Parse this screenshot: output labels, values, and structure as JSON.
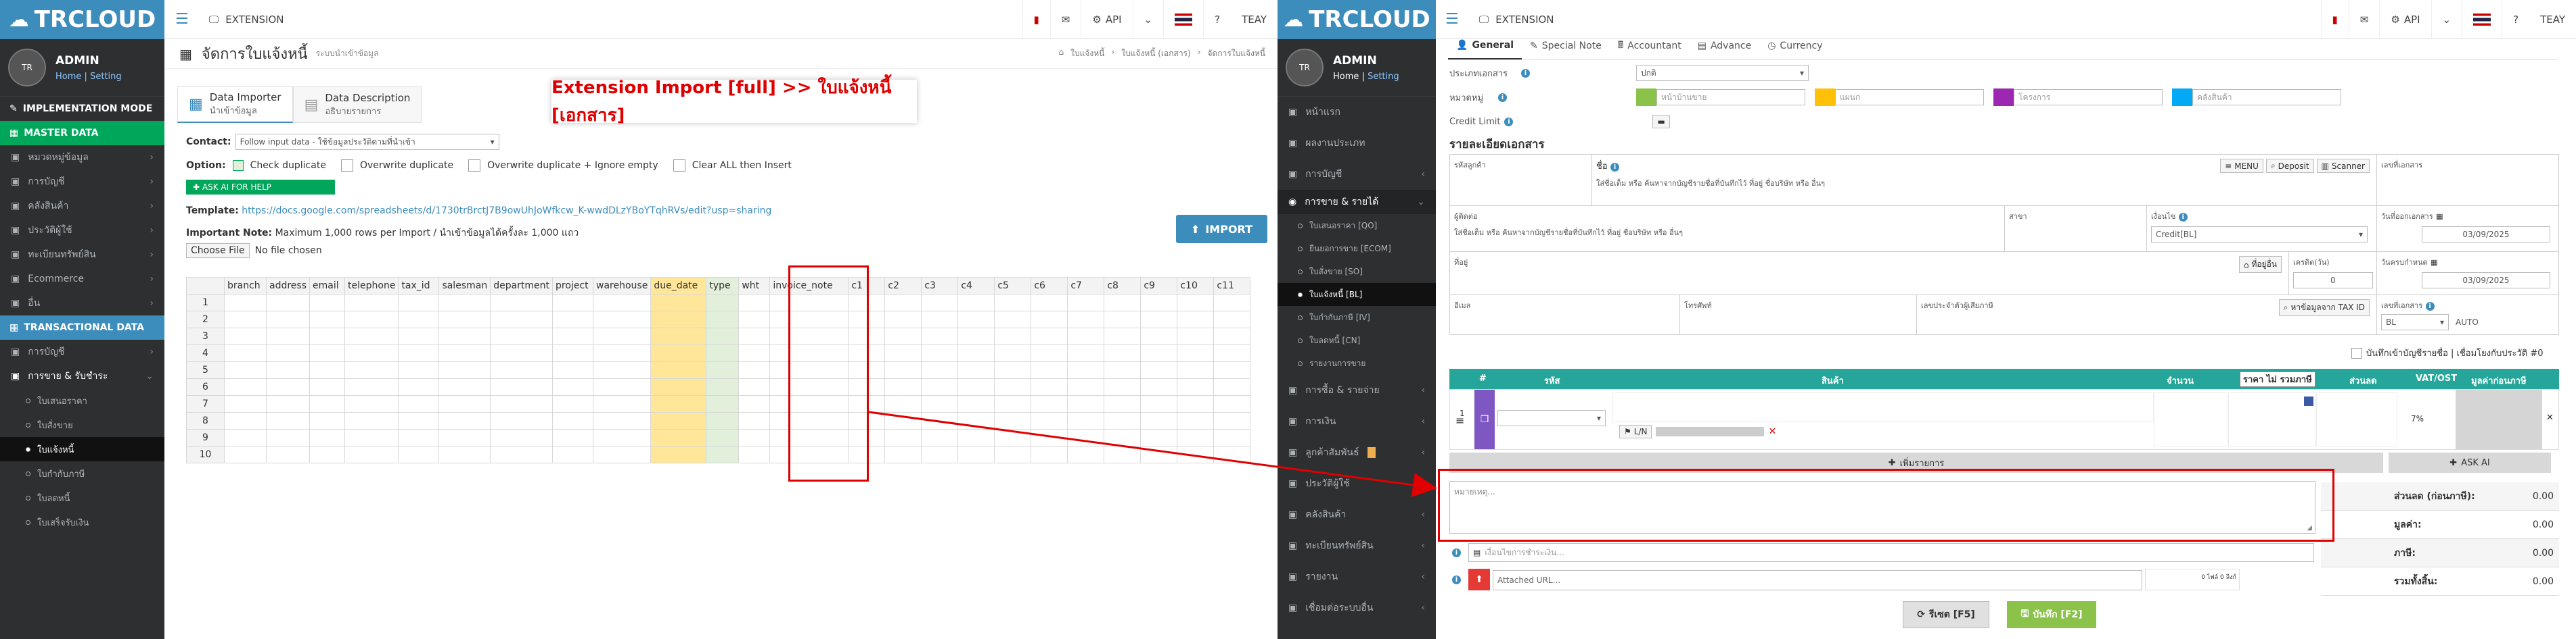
{
  "left_app": {
    "brand": "TRCLOUD",
    "user": {
      "name": "ADMIN",
      "home": "Home",
      "setting": "Setting",
      "sep": "|"
    },
    "topbar": {
      "extension": "EXTENSION",
      "api": "API",
      "user_short": "TEAY"
    },
    "sidebar": {
      "impl_mode": "IMPLEMENTATION MODE",
      "master_data": "MASTER DATA",
      "master_items": [
        "หมวดหมู่ข้อมูล",
        "การบัญชี",
        "คลังสินค้า",
        "ประวัติผู้ใช้",
        "ทะเบียนทรัพย์สิน",
        "Ecommerce",
        "อื่น"
      ],
      "transactional": "TRANSACTIONAL DATA",
      "trans_items": [
        "การบัญชี",
        "การขาย & รับชำระ"
      ],
      "sub_items": [
        "ใบเสนอราคา",
        "ใบสั่งขาย",
        "ใบแจ้งหนี้",
        "ใบกำกับภาษี",
        "ใบลดหนี้",
        "ใบเสร็จรับเงิน"
      ],
      "active_sub": 2
    },
    "page": {
      "title": "จัดการใบแจ้งหนี้",
      "subtitle": "ระบบนำเข้าข้อมูล",
      "breadcrumb": [
        "ใบแจ้งหนี้",
        "ใบแจ้งหนี้ (เอกสาร)",
        "จัดการใบแจ้งหนี้"
      ],
      "tabs": [
        {
          "title": "Data Importer",
          "sub": "นำเข้าข้อมูล"
        },
        {
          "title": "Data Description",
          "sub": "อธิบายรายการ"
        }
      ],
      "contact_label": "Contact:",
      "contact_value": "Follow input data - ใช้ข้อมูลประวัติตามที่นำเข้า",
      "option_label": "Option:",
      "options": [
        "Check duplicate",
        "Overwrite duplicate",
        "Overwrite duplicate + Ignore empty",
        "Clear ALL then Insert"
      ],
      "ask_ai": "ASK AI FOR HELP",
      "template_label": "Template:",
      "template_url": "https://docs.google.com/spreadsheets/d/1730trBrctJ7B9owUhJoWfkcw_K-wwdDLzYBoYTqhRVs/edit?usp=sharing",
      "important_label": "Important Note:",
      "important_text": "Maximum 1,000 rows per Import / นำเข้าข้อมูลได้ครั้งละ 1,000 แถว",
      "choose_file": "Choose File",
      "no_file": "No file chosen",
      "import_btn": "IMPORT",
      "columns": [
        "branch",
        "address",
        "email",
        "telephone",
        "tax_id",
        "salesman",
        "department",
        "project",
        "warehouse",
        "due_date",
        "type",
        "wht",
        "invoice_note",
        "c1",
        "c2",
        "c3",
        "c4",
        "c5",
        "c6",
        "c7",
        "c8",
        "c9",
        "c10",
        "c11"
      ],
      "rows": [
        "1",
        "2",
        "3",
        "4",
        "5",
        "6",
        "7",
        "8",
        "9",
        "10"
      ]
    },
    "annotation": "Extension Import [full] >> ใบแจ้งหนี้ [เอกสาร]"
  },
  "right_app": {
    "brand": "TRCLOUD",
    "user": {
      "name": "ADMIN",
      "home": "Home",
      "setting": "Setting",
      "sep": "|"
    },
    "topbar": {
      "extension": "EXTENSION",
      "api": "API",
      "user_short": "TEAY"
    },
    "sidebar": {
      "items_top": [
        "หน้าแรก",
        "ผลงานประเภท",
        "การบัญชี"
      ],
      "sales": "การขาย & รายได้",
      "sales_subs": [
        "ใบเสนอราคา [QO]",
        "ยืนยอการขาย [ECOM]",
        "ใบสั่งขาย [SO]",
        "ใบแจ้งหนี้ [BL]",
        "ใบกำกับภาษี [IV]",
        "ใบลดหนี้ [CN]",
        "รายงานการขาย"
      ],
      "active_sub": 3,
      "items_bottom": [
        "การซื้อ & รายจ่าย",
        "การเงิน",
        "ลูกค้าสัมพันธ์",
        "ประวัติผู้ใช้",
        "คลังสินค้า",
        "ทะเบียนทรัพย์สิน",
        "รายงาน",
        "เชื่อมต่อระบบอื่น"
      ]
    },
    "tabs": [
      "General",
      "Special Note",
      "Accountant",
      "Advance",
      "Currency"
    ],
    "form": {
      "doc_type_label": "ประเภทเอกสาร",
      "doc_type_value": "ปกติ",
      "category_label": "หมวดหมู่",
      "cat_placeholders": [
        "หน้าบ้านขาย",
        "แผนก",
        "โครงการ",
        "คลังสินค้า"
      ],
      "credit_limit": "Credit Limit",
      "section_title": "รายละเอียดเอกสาร",
      "customer_code": "รหัสลูกค้า",
      "name_label": "ชื่อ",
      "name_hint": "ใส่ชื่อเต็ม หรือ ค้นหาจากบัญชีรายชื่อที่บันทึกไว้ ที่อยู่ ชื่อบริษัท หรือ อื่นๆ",
      "btn_menu": "MENU",
      "btn_deposit": "Deposit",
      "btn_scanner": "Scanner",
      "doc_no_label": "เลขที่เอกสาร",
      "contact_label": "ผู้ติดต่อ",
      "branch_label": "สาขา",
      "term_label": "เงื่อนไข",
      "term_value": "Credit[BL]",
      "doc_date_label": "วันที่ออกเอกสาร",
      "doc_date": "03/09/2025",
      "address_label": "ที่อยู่",
      "addr_btn": "ที่อยู่อื่น",
      "credit_days_label": "เครดิต(วัน)",
      "credit_days": "0",
      "due_label": "วันครบกำหนด",
      "due_date": "03/09/2025",
      "email_label": "อีเมล",
      "phone_label": "โทรศัพท์",
      "tax_label": "เลขประจำตัวผู้เสียภาษี",
      "tax_btn": "หาข้อมูลจาก TAX ID",
      "docno2_label": "เลขที่เอกสาร",
      "docno2_value": "BL",
      "auto": "AUTO",
      "save_check": "บันทึกเข้าบัญชีรายชื่อ | เชื่อมโยงกับประวัติ #0"
    },
    "table": {
      "headers": [
        "#",
        "รหัส",
        "สินค้า",
        "จำนวน",
        "ราคา ไม่ รวมภาษี",
        "ส่วนลด",
        "VAT/OST",
        "มูลค่าก่อนภาษี"
      ],
      "row_no": "1",
      "lin": "L/N",
      "vat": "7%",
      "add_item": "เพิ่มรายการ",
      "ask_ai": "ASK AI"
    },
    "note": {
      "placeholder": "หมายเหตุ..."
    },
    "condition_placeholder": "เงื่อนไขการชำระเงิน...",
    "attached": "Attached URL...",
    "summary": [
      {
        "label": "ส่วนลด (ก่อนภาษี):",
        "value": "0.00"
      },
      {
        "label": "มูลค่า:",
        "value": "0.00"
      },
      {
        "label": "ภาษี:",
        "value": "0.00"
      },
      {
        "label": "รวมทั้งสิ้น:",
        "value": "0.00"
      }
    ],
    "btn_reset": "รีเซต [F5]",
    "btn_save": "บันทึก [F2]",
    "mini": "0 ไฟล์ 0 ลิงก์"
  },
  "colors": {
    "brand_blue": "#3c8dbc",
    "green": "#00a65a",
    "teal": "#26a69a",
    "annotation_red": "#e00000"
  }
}
